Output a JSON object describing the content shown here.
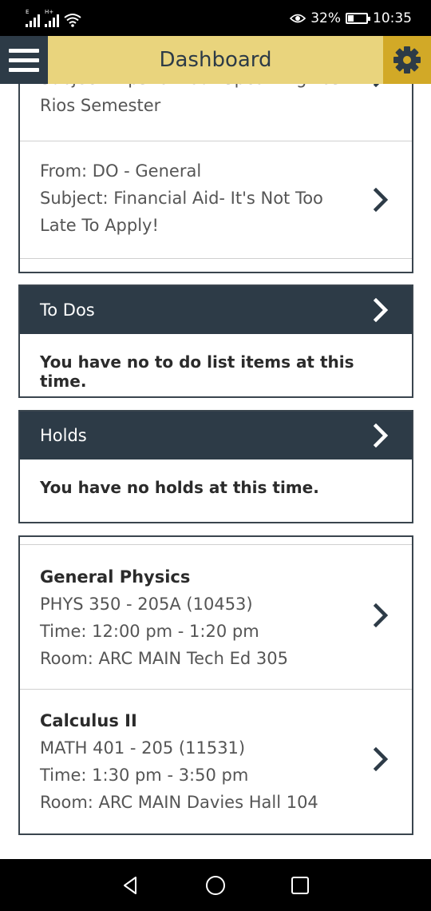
{
  "status": {
    "network_left": "E",
    "network_right": "H+",
    "battery": "32%",
    "battery_level": 0.32,
    "time": "10:35"
  },
  "header": {
    "title": "Dashboard",
    "menu_icon": "hamburger-icon",
    "settings_icon": "gear-icon",
    "colors": {
      "bar": "#e9d47d",
      "menu_bg": "#2d3b47",
      "settings_bg": "#d2a927"
    }
  },
  "messages": [
    {
      "partial_line": "Subject: Tips for Your Upcoming Los",
      "continuation": "Rios Semester"
    },
    {
      "from": "From: DO - General",
      "subject_line1": "Subject: Financial Aid- It's Not Too",
      "subject_line2": "Late To Apply!"
    }
  ],
  "todos": {
    "title": "To Dos",
    "empty_message": "You have no to do list items at this time."
  },
  "holds": {
    "title": "Holds",
    "empty_message": "You have no holds at this time."
  },
  "classes": [
    {
      "name": "General Physics",
      "code": "PHYS 350 - 205A (10453)",
      "time": "Time: 12:00 pm - 1:20 pm",
      "room": "Room: ARC MAIN Tech Ed 305"
    },
    {
      "name": "Calculus II",
      "code": "MATH 401 - 205 (11531)",
      "time": "Time: 1:30 pm - 3:50 pm",
      "room": "Room: ARC MAIN Davies Hall 104"
    }
  ],
  "nav": {
    "back_icon": "back-icon",
    "home_icon": "home-icon",
    "recents_icon": "recents-icon"
  }
}
